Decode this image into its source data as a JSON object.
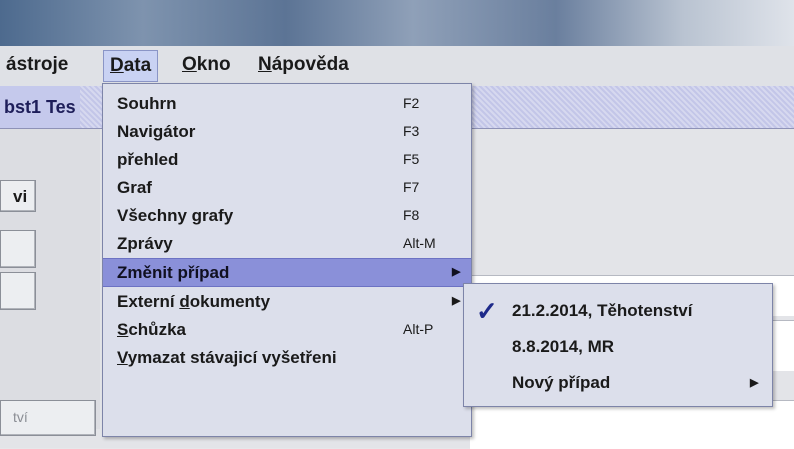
{
  "menubar": {
    "items": [
      {
        "label": "ástroje",
        "underline": "á"
      },
      {
        "label": "Data",
        "underline": "D"
      },
      {
        "label": "Okno",
        "underline": "O"
      },
      {
        "label": "Nápověda",
        "underline": "N"
      }
    ]
  },
  "window": {
    "title": "bst1 Tes"
  },
  "left_buttons": {
    "b1": "vi",
    "b2": "",
    "b3": "",
    "bottom": "tví"
  },
  "data_menu": {
    "items": [
      {
        "label": "Souhrn",
        "shortcut": "F2"
      },
      {
        "label": "Navigátor",
        "shortcut": "F3"
      },
      {
        "label": "přehled",
        "shortcut": "F5"
      },
      {
        "label": "Graf",
        "shortcut": "F7"
      },
      {
        "label": "Všechny grafy",
        "shortcut": "F8"
      },
      {
        "label": "Zprávy",
        "shortcut": "Alt-M"
      },
      {
        "label": "Změnit případ",
        "shortcut": "",
        "submenu": true,
        "highlighted": true
      },
      {
        "label": "Externí dokumenty",
        "shortcut": "",
        "submenu": true
      },
      {
        "label": "Schůzka",
        "shortcut": "Alt-P"
      },
      {
        "label": "Vymazat stávajicí vyšetřeni",
        "shortcut": ""
      }
    ],
    "highlight_color": "#8a90d9"
  },
  "case_submenu": {
    "items": [
      {
        "label": "21.2.2014, Těhotenství",
        "checked": true
      },
      {
        "label": "8.8.2014, MR",
        "checked": false
      },
      {
        "label": "Nový případ",
        "checked": false,
        "submenu": true
      }
    ]
  },
  "icons": {
    "check": "checkmark-icon",
    "submenu": "triangle-right-icon"
  }
}
